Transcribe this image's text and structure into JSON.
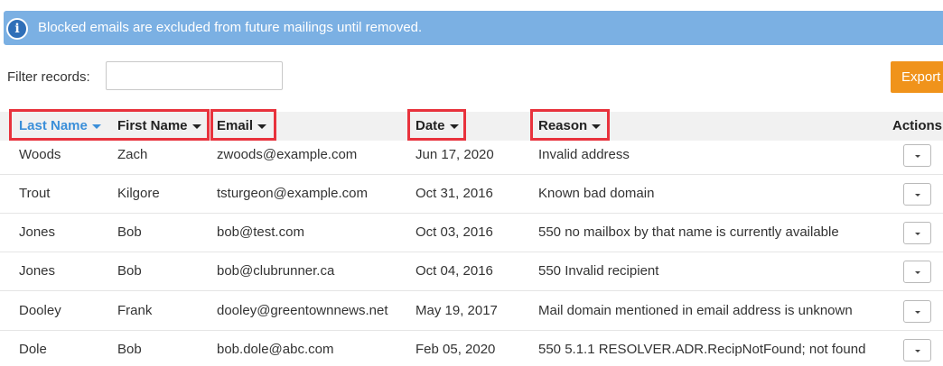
{
  "banner": {
    "icon": "info-icon",
    "icon_glyph": "i",
    "text": "Blocked emails are excluded from future mailings until removed.",
    "color": "#7bb0e3"
  },
  "filter": {
    "label": "Filter records:",
    "value": "",
    "placeholder": ""
  },
  "export": {
    "label": "Export",
    "color": "#f0931b"
  },
  "table": {
    "columns": {
      "last_name": "Last Name",
      "first_name": "First Name",
      "email": "Email",
      "date": "Date",
      "reason": "Reason",
      "actions": "Actions"
    },
    "sorted_column": "last_name",
    "highlight_color": "#e8323c",
    "rows": [
      {
        "last_name": "Woods",
        "first_name": "Zach",
        "email": "zwoods@example.com",
        "date": "Jun 17, 2020",
        "reason": "Invalid address"
      },
      {
        "last_name": "Trout",
        "first_name": "Kilgore",
        "email": "tsturgeon@example.com",
        "date": "Oct 31, 2016",
        "reason": "Known bad domain"
      },
      {
        "last_name": "Jones",
        "first_name": "Bob",
        "email": "bob@test.com",
        "date": "Oct 03, 2016",
        "reason": "550 no mailbox by that name is currently available"
      },
      {
        "last_name": "Jones",
        "first_name": "Bob",
        "email": "bob@clubrunner.ca",
        "date": "Oct 04, 2016",
        "reason": "550 Invalid recipient"
      },
      {
        "last_name": "Dooley",
        "first_name": "Frank",
        "email": "dooley@greentownnews.net",
        "date": "May 19, 2017",
        "reason": "Mail domain mentioned in email address is unknown"
      },
      {
        "last_name": "Dole",
        "first_name": "Bob",
        "email": "bob.dole@abc.com",
        "date": "Feb 05, 2020",
        "reason": "550 5.1.1 RESOLVER.ADR.RecipNotFound; not found"
      }
    ]
  }
}
